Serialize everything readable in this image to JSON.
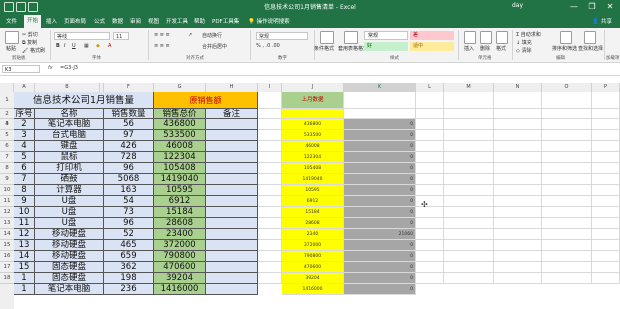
{
  "window": {
    "title": "信息技术公司1月销售清单 - Excel",
    "user": "day",
    "minimize": "—",
    "restore": "❐",
    "close": "✕"
  },
  "tabs": [
    "文件",
    "开始",
    "插入",
    "页面布局",
    "公式",
    "数据",
    "审阅",
    "视图",
    "开发工具",
    "帮助",
    "PDF工具集",
    "操作说明搜索"
  ],
  "active_tab": "开始",
  "share_label": "共享",
  "ribbon": {
    "clipboard": {
      "label": "剪贴板",
      "paste": "粘贴",
      "cut": "剪切",
      "copy": "复制",
      "format_painter": "格式刷"
    },
    "font": {
      "label": "字体",
      "name": "等线",
      "size": "11"
    },
    "alignment": {
      "label": "对齐方式",
      "wrap": "自动换行",
      "merge": "合并后居中"
    },
    "number": {
      "label": "数字",
      "format": "常规"
    },
    "styles": {
      "label": "样式",
      "conditional": "条件格式",
      "table": "套用表格格式",
      "cell_styles": [
        {
          "text": "常规",
          "color": "#ffffff",
          "fg": "#333333"
        },
        {
          "text": "差",
          "color": "#ffc7ce",
          "fg": "#9c0006"
        },
        {
          "text": "好",
          "color": "#c6efce",
          "fg": "#006100"
        },
        {
          "text": "适中",
          "color": "#ffeb9c",
          "fg": "#9c6500"
        }
      ]
    },
    "cells": {
      "label": "单元格",
      "insert": "插入",
      "delete": "删除",
      "format": "格式"
    },
    "editing": {
      "label": "编辑",
      "autosum": "自动求和",
      "fill": "填充",
      "clear": "清除",
      "sort": "排序和筛选",
      "find": "查找和选择"
    },
    "addins": {
      "label": "加载项"
    }
  },
  "namebox": "K3",
  "fx": "fx",
  "formula": "=G3-J3",
  "columns": [
    "A",
    "B",
    "C",
    "F",
    "G",
    "H",
    "I",
    "J",
    "K",
    "L",
    "M",
    "N",
    "O",
    "P"
  ],
  "selected_column": "K",
  "rows": [
    "1",
    "2",
    "3",
    "4",
    "5",
    "6",
    "7",
    "8",
    "9",
    "10",
    "11",
    "12",
    "13",
    "14",
    "15",
    "16",
    "17",
    "18"
  ],
  "sheet_title": "信息技术公司1月销售量",
  "orange_header": "原销售额",
  "right_header": "上月数据",
  "headers": {
    "seq": "序号",
    "name": "名称",
    "qty": "销售数量",
    "total": "销售总价",
    "note": "备注"
  },
  "data_rows": [
    {
      "seq": "1",
      "name": "笔记本电脑",
      "qty": "98",
      "total": "588000",
      "j": "588000",
      "k": "0"
    },
    {
      "seq": "2",
      "name": "笔记本电脑",
      "qty": "56",
      "total": "436800",
      "j": "436800",
      "k": "0"
    },
    {
      "seq": "3",
      "name": "台式电脑",
      "qty": "97",
      "total": "533500",
      "j": "533500",
      "k": "0"
    },
    {
      "seq": "4",
      "name": "键盘",
      "qty": "426",
      "total": "46008",
      "j": "46008",
      "k": "0"
    },
    {
      "seq": "5",
      "name": "鼠标",
      "qty": "728",
      "total": "122304",
      "j": "122304",
      "k": "0"
    },
    {
      "seq": "6",
      "name": "打印机",
      "qty": "96",
      "total": "105408",
      "j": "105408",
      "k": "0"
    },
    {
      "seq": "7",
      "name": "硒鼓",
      "qty": "5068",
      "total": "1419040",
      "j": "1419040",
      "k": "0"
    },
    {
      "seq": "8",
      "name": "计算器",
      "qty": "163",
      "total": "10595",
      "j": "10595",
      "k": "0"
    },
    {
      "seq": "9",
      "name": "U盘",
      "qty": "54",
      "total": "6912",
      "j": "6912",
      "k": "0"
    },
    {
      "seq": "10",
      "name": "U盘",
      "qty": "73",
      "total": "15184",
      "j": "15184",
      "k": "0"
    },
    {
      "seq": "11",
      "name": "U盘",
      "qty": "96",
      "total": "28608",
      "j": "28608",
      "k": "0"
    },
    {
      "seq": "12",
      "name": "移动硬盘",
      "qty": "52",
      "total": "23400",
      "j": "2340",
      "k": "21060"
    },
    {
      "seq": "13",
      "name": "移动硬盘",
      "qty": "465",
      "total": "372000",
      "j": "372000",
      "k": "0"
    },
    {
      "seq": "14",
      "name": "移动硬盘",
      "qty": "659",
      "total": "790800",
      "j": "790800",
      "k": "0"
    },
    {
      "seq": "15",
      "name": "固态硬盘",
      "qty": "362",
      "total": "470600",
      "j": "470600",
      "k": "0"
    },
    {
      "seq": "1",
      "name": "固态硬盘",
      "qty": "198",
      "total": "39204",
      "j": "39204",
      "k": "0"
    },
    {
      "seq": "1",
      "name": "笔记本电脑",
      "qty": "236",
      "total": "1416000",
      "j": "1416000",
      "k": "0"
    }
  ],
  "colors": {
    "accent": "#217346",
    "orange": "#ffc000",
    "yellow": "#ffff00",
    "blue": "#dae3f3",
    "green": "#a9d08e",
    "gray": "#a6a6a6",
    "red_text": "#c00000"
  }
}
